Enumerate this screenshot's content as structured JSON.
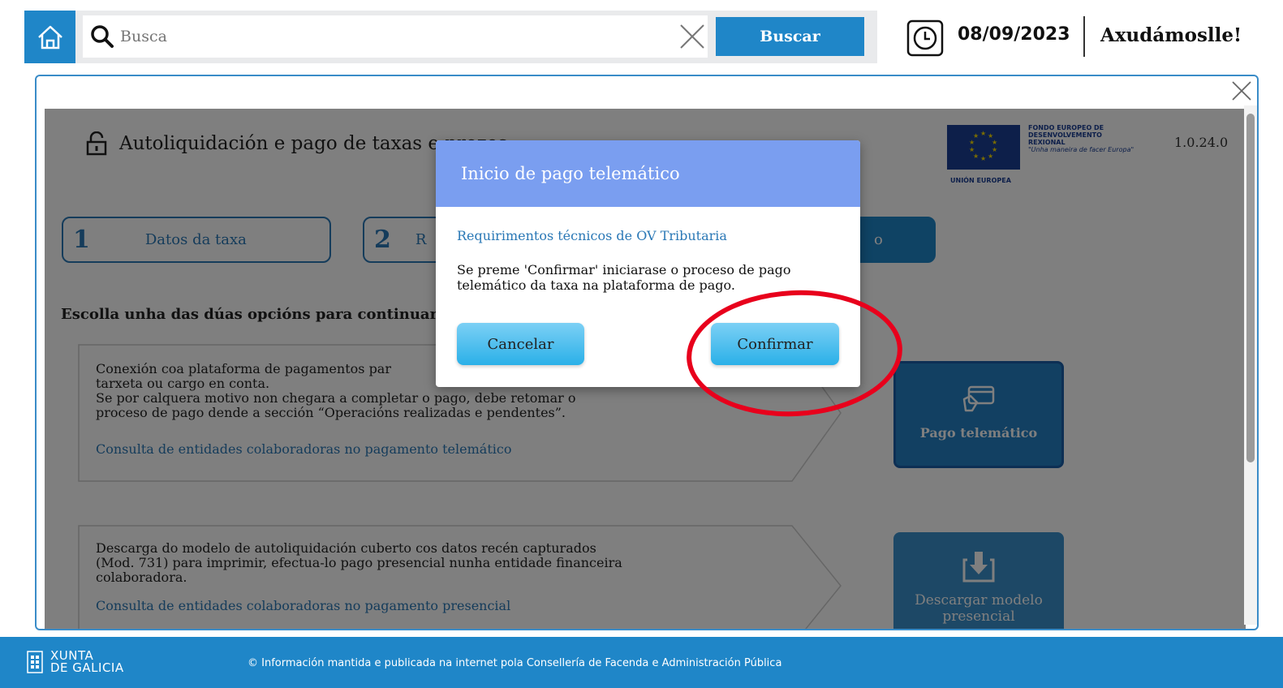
{
  "topbar": {
    "search_placeholder": "Busca",
    "search_button": "Buscar",
    "date": "08/09/2023",
    "help": "Axudámoslle!"
  },
  "page": {
    "title": "Autoliquidación e pago de taxas e prezos",
    "version": "1.0.24.0",
    "eu": {
      "caption": "UNIÓN EUROPEA",
      "fund_line1": "FONDO EUROPEO DE",
      "fund_line2": "DESENVOLVEMENTO",
      "fund_line3": "REXIONAL",
      "slogan": "\"Unha maneira de facer Europa\""
    },
    "steps": [
      {
        "num": "1",
        "label": "Datos da taxa"
      },
      {
        "num": "2",
        "label": "R"
      },
      {
        "label": "o"
      }
    ],
    "choose_text": "Escolla unha das dúas opcións para continuar",
    "options": [
      {
        "line1": "Conexión coa plataforma de pagamentos par",
        "line2": "tarxeta ou cargo en conta.",
        "line3": "Se por calquera motivo non chegara a completar o pago, debe retomar o",
        "line4": "proceso de pago dende a sección “Operacións realizadas e pendentes”.",
        "link": "Consulta de entidades colaboradoras no pagamento telemático",
        "action": "Pago telemático"
      },
      {
        "line1": "Descarga do modelo de autoliquidación cuberto cos datos recén capturados",
        "line2": "(Mod. 731) para imprimir, efectua-lo pago presencial nunha entidade financeira",
        "line3": "colaboradora.",
        "link": "Consulta de entidades colaboradoras no pagamento presencial",
        "action_line1": "Descargar modelo",
        "action_line2": "presencial"
      }
    ]
  },
  "modal": {
    "title": "Inicio de pago telemático",
    "link": "Requirimentos técnicos de OV Tributaria",
    "message": "Se preme 'Confirmar' iniciarase o proceso de pago telemático da taxa na plataforma de pago.",
    "cancel": "Cancelar",
    "confirm": "Confirmar"
  },
  "footer": {
    "logo_line1": "XUNTA",
    "logo_line2": "DE GALICIA",
    "text": "© Información mantida e publicada na internet pola Consellería de Facenda e Administración Pública"
  },
  "colors": {
    "primary": "#1f86c8",
    "modal_header": "#7a9ef0",
    "highlight": "#e8001c"
  }
}
